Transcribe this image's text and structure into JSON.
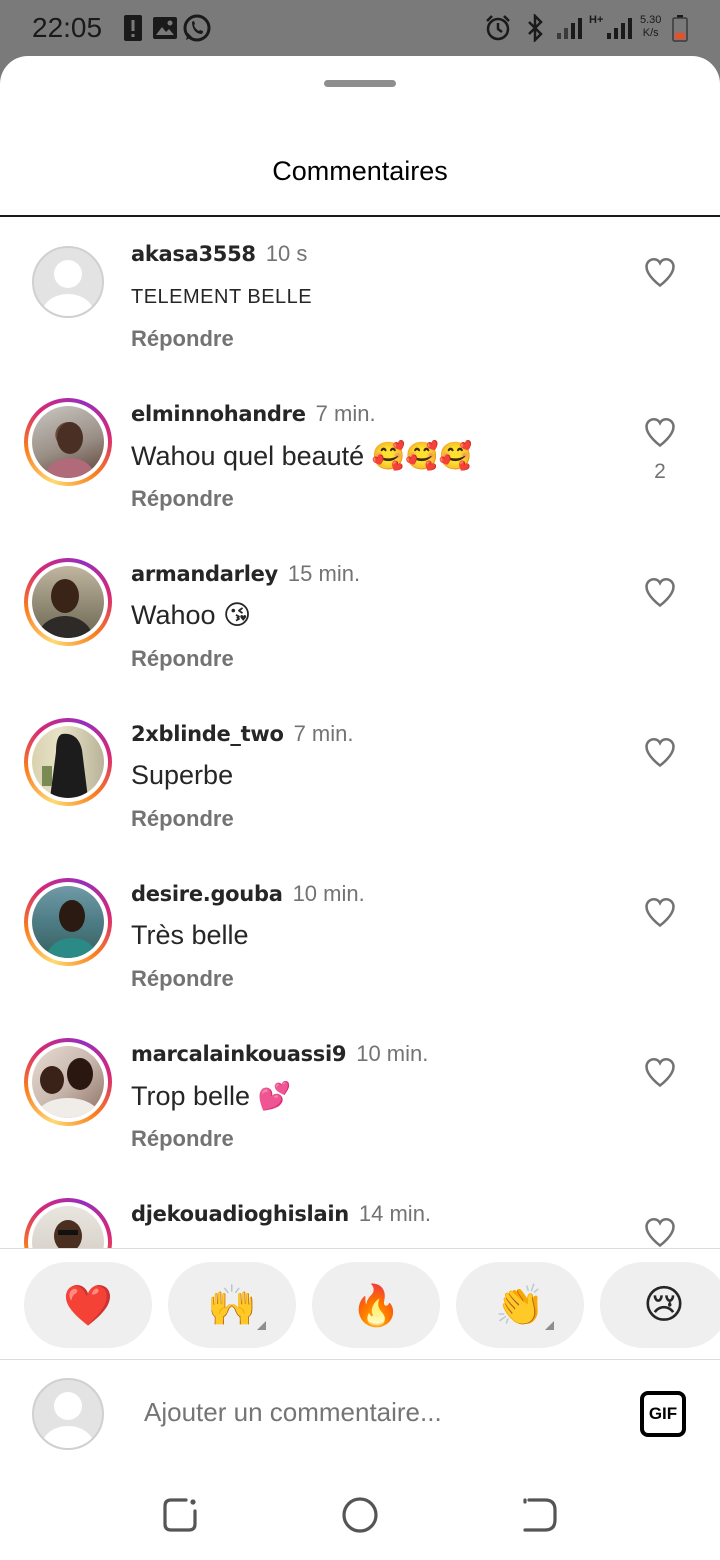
{
  "status_bar": {
    "time": "22:05",
    "network": "H+",
    "speed_value": "5.30",
    "speed_unit": "K/s",
    "icons": [
      "alert-icon",
      "image-icon",
      "whatsapp-icon",
      "alarm-icon",
      "bluetooth-icon",
      "signal-icon",
      "battery-icon"
    ]
  },
  "sheet": {
    "title": "Commentaires"
  },
  "comments": [
    {
      "username": "akasa3558",
      "time": "10 s",
      "text": "TELEMENT BELLE",
      "reply": "Répondre",
      "likes": "",
      "avatar": "default"
    },
    {
      "username": "elminnohandre",
      "time": "7 min.",
      "text": "Wahou quel beauté 🥰🥰🥰",
      "reply": "Répondre",
      "likes": "2",
      "avatar": "photo"
    },
    {
      "username": "armandarley",
      "time": "15 min.",
      "text": "Wahoo 😘",
      "reply": "Répondre",
      "likes": "",
      "avatar": "photo"
    },
    {
      "username": "2xblinde_two",
      "time": "7 min.",
      "text": "Superbe",
      "reply": "Répondre",
      "likes": "",
      "avatar": "photo"
    },
    {
      "username": "desire.gouba",
      "time": "10 min.",
      "text": "Très belle",
      "reply": "Répondre",
      "likes": "",
      "avatar": "photo"
    },
    {
      "username": "marcalainkouassi9",
      "time": "10 min.",
      "text": "Trop belle 💕",
      "reply": "Répondre",
      "likes": "",
      "avatar": "photo"
    },
    {
      "username": "djekouadioghislain",
      "time": "14 min.",
      "text": "",
      "reply": "",
      "likes": "",
      "avatar": "photo"
    }
  ],
  "reactions": [
    {
      "emoji": "❤️",
      "name": "heart"
    },
    {
      "emoji": "🙌",
      "name": "raising-hands"
    },
    {
      "emoji": "🔥",
      "name": "fire"
    },
    {
      "emoji": "👏",
      "name": "clapping-hands"
    },
    {
      "emoji": "😢",
      "name": "crying-face"
    }
  ],
  "composer": {
    "placeholder": "Ajouter un commentaire...",
    "gif_label": "GIF"
  },
  "colors": {
    "status_bar_bg": "#7a7a7a",
    "accent_ring_start": "#fa7e1e",
    "accent_ring_end": "#d62976",
    "secondary_text": "#737373"
  }
}
